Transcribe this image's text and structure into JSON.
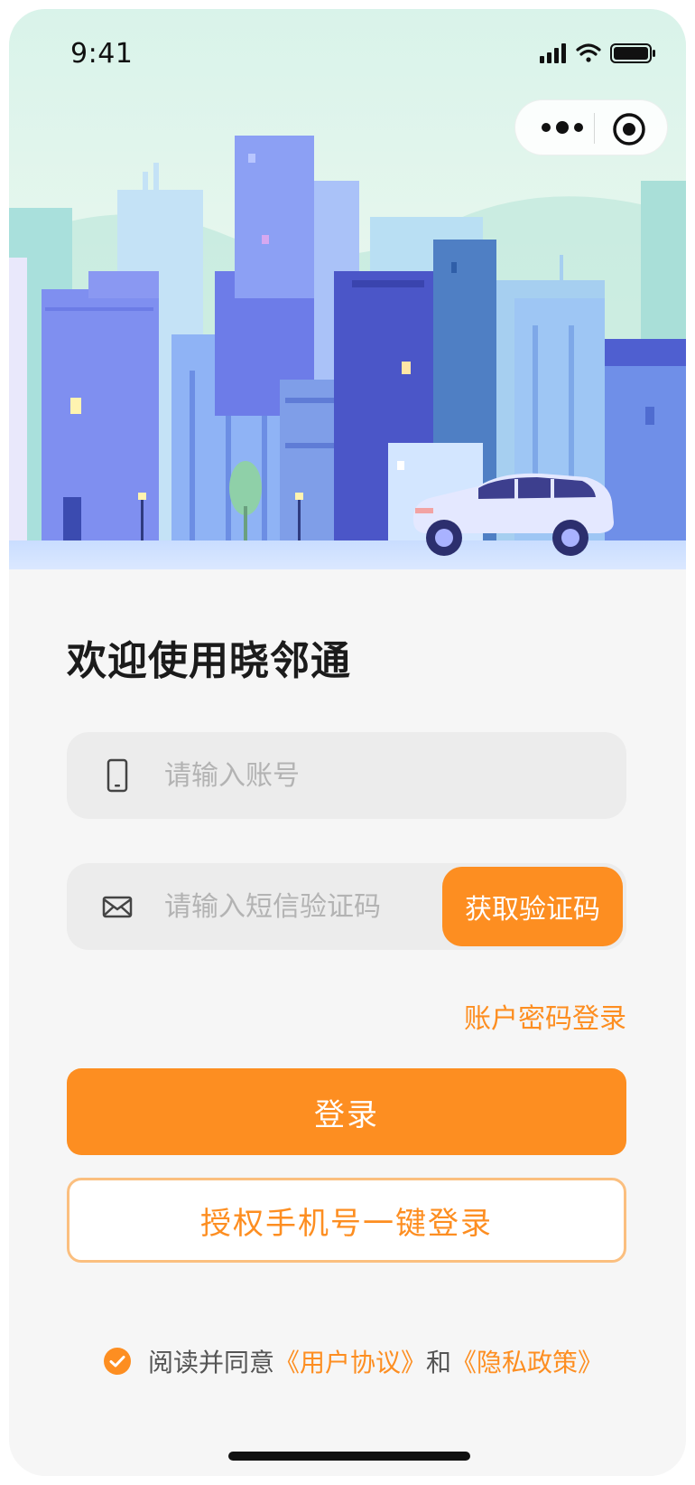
{
  "status_bar": {
    "time": "9:41"
  },
  "capsule": {
    "more_icon": "more-dots-icon",
    "close_icon": "target-circle-icon"
  },
  "login": {
    "title": "欢迎使用晓邻通",
    "account_placeholder": "请输入账号",
    "account_icon": "phone-icon",
    "sms_placeholder": "请输入短信验证码",
    "sms_icon": "mail-icon",
    "get_code_label": "获取验证码",
    "password_login_link": "账户密码登录",
    "login_button": "登录",
    "phone_auth_button": "授权手机号一键登录"
  },
  "agreement": {
    "prefix": "阅读并同意",
    "user_agreement": "《用户协议》",
    "and": "和",
    "privacy_policy": "《隐私政策》",
    "checked": true
  },
  "colors": {
    "accent": "#fd8e21",
    "accent_border": "#fbbf7f",
    "background": "#f6f6f6",
    "field_bg": "#ececec"
  }
}
